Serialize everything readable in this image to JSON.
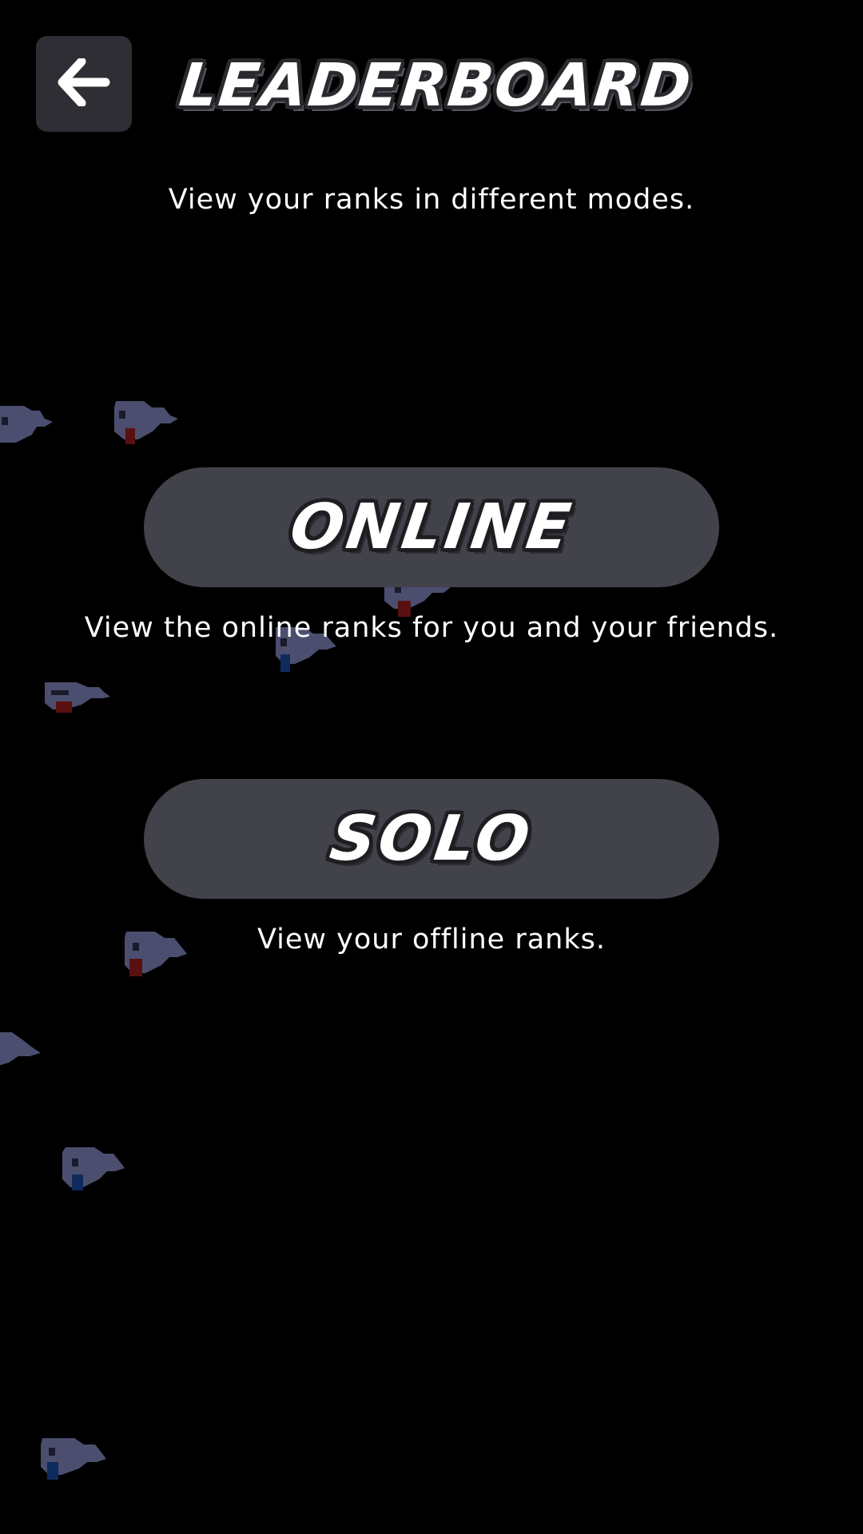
{
  "header": {
    "title": "LEADERBOARD",
    "back_icon": "arrow-left-icon"
  },
  "subtitle": "View your ranks in different modes.",
  "modes": [
    {
      "label": "ONLINE",
      "description": "View the online ranks for you and your friends."
    },
    {
      "label": "SOLO",
      "description": "View your offline ranks."
    }
  ],
  "colors": {
    "background": "#000000",
    "button": "#42424b",
    "back_button": "#2e2e34",
    "ghost_body": "#4b4e6e",
    "ghost_tongue_red": "#5a1010",
    "ghost_tongue_blue": "#0f2a5c",
    "text": "#ffffff"
  }
}
